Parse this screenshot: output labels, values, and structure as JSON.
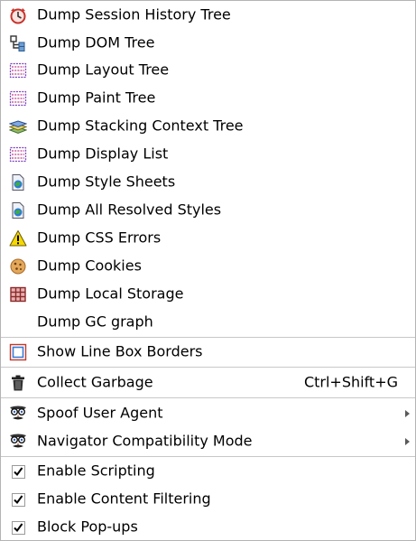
{
  "menu": {
    "items": [
      {
        "label": "Dump Session History Tree",
        "icon": "session-history-icon"
      },
      {
        "label": "Dump DOM Tree",
        "icon": "dom-tree-icon"
      },
      {
        "label": "Dump Layout Tree",
        "icon": "layout-tree-icon"
      },
      {
        "label": "Dump Paint Tree",
        "icon": "paint-tree-icon"
      },
      {
        "label": "Dump Stacking Context Tree",
        "icon": "stacking-layers-icon"
      },
      {
        "label": "Dump Display List",
        "icon": "display-list-icon"
      },
      {
        "label": "Dump Style Sheets",
        "icon": "style-sheet-icon"
      },
      {
        "label": "Dump All Resolved Styles",
        "icon": "style-sheet-icon"
      },
      {
        "label": "Dump CSS Errors",
        "icon": "warning-icon"
      },
      {
        "label": "Dump Cookies",
        "icon": "cookie-icon"
      },
      {
        "label": "Dump Local Storage",
        "icon": "storage-grid-icon"
      },
      {
        "label": "Dump GC graph",
        "icon": ""
      },
      {
        "label": "Show Line Box Borders",
        "icon": "line-box-borders-icon"
      },
      {
        "label": "Collect Garbage",
        "icon": "trash-icon",
        "shortcut": "Ctrl+Shift+G"
      },
      {
        "label": "Spoof User Agent",
        "icon": "spy-mask-icon",
        "submenu": true
      },
      {
        "label": "Navigator Compatibility Mode",
        "icon": "spy-mask-icon",
        "submenu": true
      },
      {
        "label": "Enable Scripting",
        "icon": "checkbox-checked-icon",
        "checked": true
      },
      {
        "label": "Enable Content Filtering",
        "icon": "checkbox-checked-icon",
        "checked": true
      },
      {
        "label": "Block Pop-ups",
        "icon": "checkbox-checked-icon",
        "checked": true
      }
    ]
  },
  "colors": {
    "border": "#b4b4b4",
    "separator": "#c8c8c8",
    "text": "#000000"
  }
}
